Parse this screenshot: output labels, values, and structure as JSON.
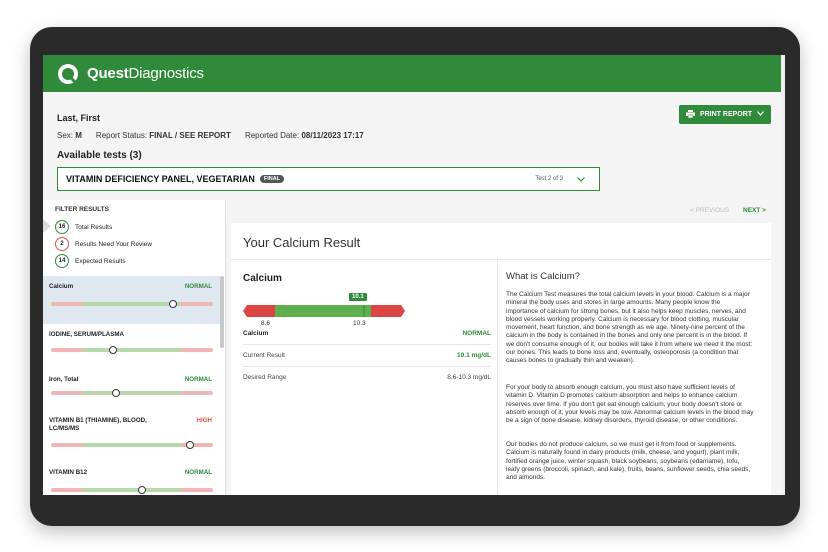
{
  "brand": {
    "name_bold": "Quest",
    "name_light": "Diagnostics",
    "color": "#2f8a3a"
  },
  "patient": {
    "name": "Last, First",
    "sex_label": "Sex:",
    "sex": "M",
    "status_label": "Report Status:",
    "status": "FINAL / SEE REPORT",
    "date_label": "Reported Date:",
    "date": "08/11/2023 17:17"
  },
  "available_tests": "Available tests (3)",
  "print_button": "PRINT REPORT",
  "test_selector": {
    "name": "VITAMIN DEFICIENCY PANEL, VEGETARIAN",
    "badge": "FINAL",
    "count": "Test 2 of 3"
  },
  "filters": {
    "heading": "FILTER RESULTS",
    "items": [
      {
        "count": "16",
        "label": "Total Results"
      },
      {
        "count": "2",
        "label": "Results Need Your Review"
      },
      {
        "count": "14",
        "label": "Expected Results"
      }
    ]
  },
  "results_list": [
    {
      "name": "Calcium",
      "status": "NORMAL",
      "status_color": "#2f8a3a",
      "marker": 0.75
    },
    {
      "name": "IODINE, SERUM/PLASMA",
      "status": "",
      "status_color": "#2f8a3a",
      "marker": 0.38
    },
    {
      "name": "Iron, Total",
      "status": "NORMAL",
      "status_color": "#2f8a3a",
      "marker": 0.4
    },
    {
      "name": "VITAMIN B1 (THIAMINE), BLOOD, LC/MS/MS",
      "status": "HIGH",
      "status_color": "#d9534f",
      "marker": 0.86
    },
    {
      "name": "VITAMIN B12",
      "status": "NORMAL",
      "status_color": "#2f8a3a",
      "marker": 0.56
    }
  ],
  "nav": {
    "prev": "< PREVIOUS",
    "next": "NEXT >"
  },
  "detail": {
    "title": "Your Calcium Result",
    "analyte": "Calcium",
    "value_tag": "10.1",
    "low": "8.6",
    "high": "10.3",
    "rows": [
      {
        "key": "Calcium",
        "value": "NORMAL"
      },
      {
        "key": "Current Result",
        "value": "10.1 mg/dL"
      },
      {
        "key": "Desired Range",
        "value": "8.6-10.3 mg/dL"
      }
    ],
    "what_title": "What is Calcium?",
    "paragraphs": [
      "The Calcium Test measures the total calcium levels in your blood. Calcium is a major mineral the body uses and stores in large amounts. Many people know the importance of calcium for strong bones, but it also helps keep muscles, nerves, and blood vessels working properly. Calcium is necessary for blood clotting, muscular movement, heart function, and bone strength as we age. Ninety-nine percent of the calcium in the body is contained in the bones and only one percent is in the blood. If we don't consume enough of it, our bodies will take it from where we need it the most: our bones. This leads to bone loss and, eventually, osteoporosis (a condition that causes bones to gradually thin and weaken).",
      "For your body to absorb enough calcium, you must also have sufficient levels of vitamin D. Vitamin D promotes calcium absorption and helps to enhance calcium reserves over time. If you don't get eat enough calcium, your body doesn't store or absorb enough of it, your levels may be low. Abnormal calcium levels in the blood may be a sign of bone disease, kidney disorders, thyroid disease, or other conditions.",
      "Our bodies do not produce calcium, so we must get it from food or supplements. Calcium is naturally found in dairy products (milk, cheese, and yogurt), plant milk, fortified orange juice, winter squash, black soybeans, soybeans (edamame), tofu, leafy greens (broccoli, spinach, and kale), fruits, beans, sunflower seeds, chia seeds, and almonds."
    ]
  }
}
